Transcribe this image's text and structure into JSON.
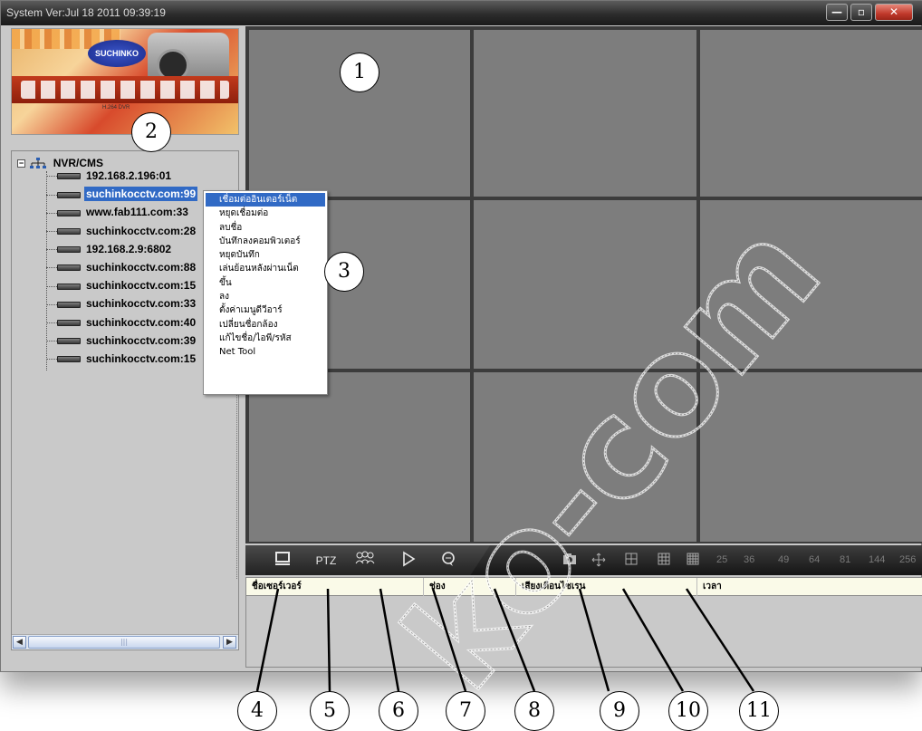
{
  "window": {
    "title": "System Ver:Jul 18 2011 09:39:19",
    "buttons": [
      "minimize",
      "restore",
      "close"
    ]
  },
  "logo": {
    "badge": "SUCHINKO",
    "subtitle": "H.264 DVR"
  },
  "tree": {
    "root_label": "NVR/CMS",
    "expander": "−",
    "items": [
      {
        "label": "192.168.2.196:01",
        "selected": false
      },
      {
        "label": "suchinkocctv.com:99",
        "selected": true
      },
      {
        "label": "www.fab111.com:33",
        "selected": false
      },
      {
        "label": "suchinkocctv.com:28",
        "selected": false
      },
      {
        "label": "192.168.2.9:6802",
        "selected": false
      },
      {
        "label": "suchinkocctv.com:88",
        "selected": false
      },
      {
        "label": "suchinkocctv.com:15",
        "selected": false
      },
      {
        "label": "suchinkocctv.com:33",
        "selected": false
      },
      {
        "label": "suchinkocctv.com:40",
        "selected": false
      },
      {
        "label": "suchinkocctv.com:39",
        "selected": false
      },
      {
        "label": "suchinkocctv.com:15",
        "selected": false
      }
    ]
  },
  "context_menu": {
    "items": [
      "เชื่อมต่ออินเตอร์เน็ต",
      "หยุดเชื่อมต่อ",
      "ลบชื่อ",
      "บันทึกลงคอมพิวเตอร์",
      "หยุดบันทึก",
      "เล่นย้อนหลังผ่านเน็ต",
      "ขึ้น",
      "ลง",
      "ตั้งค่าเมนูดีวีอาร์",
      "เปลี่ยนชื่อกล้อง",
      "แก้ไขชื่อ/ไอพี/รหัส",
      "Net Tool"
    ],
    "active_index": 0
  },
  "toolbar": {
    "monitor_icon": "monitor-icon",
    "ptz_label": "PTZ",
    "group_icon": "group-icon",
    "play_icon": "play-icon",
    "chat_icon": "chat-icon",
    "snapshot_icon": "camera-icon",
    "move_icon": "move-icon",
    "layouts": [
      "25",
      "36",
      "49",
      "64",
      "81",
      "144",
      "256"
    ]
  },
  "alarm_table": {
    "columns": [
      "ชื่อเซอร์เวอร์",
      "ช่อง",
      "เสียงเตือนไซเรน",
      "เวลา"
    ],
    "rows": []
  },
  "callouts": [
    "1",
    "2",
    "3",
    "4",
    "5",
    "6",
    "7",
    "8",
    "9",
    "10",
    "11"
  ],
  "colors": {
    "selection": "#316ac5",
    "video_cell": "#7d7d7d",
    "grid_line": "#3c3c3c",
    "panel": "#c9c9c9"
  }
}
